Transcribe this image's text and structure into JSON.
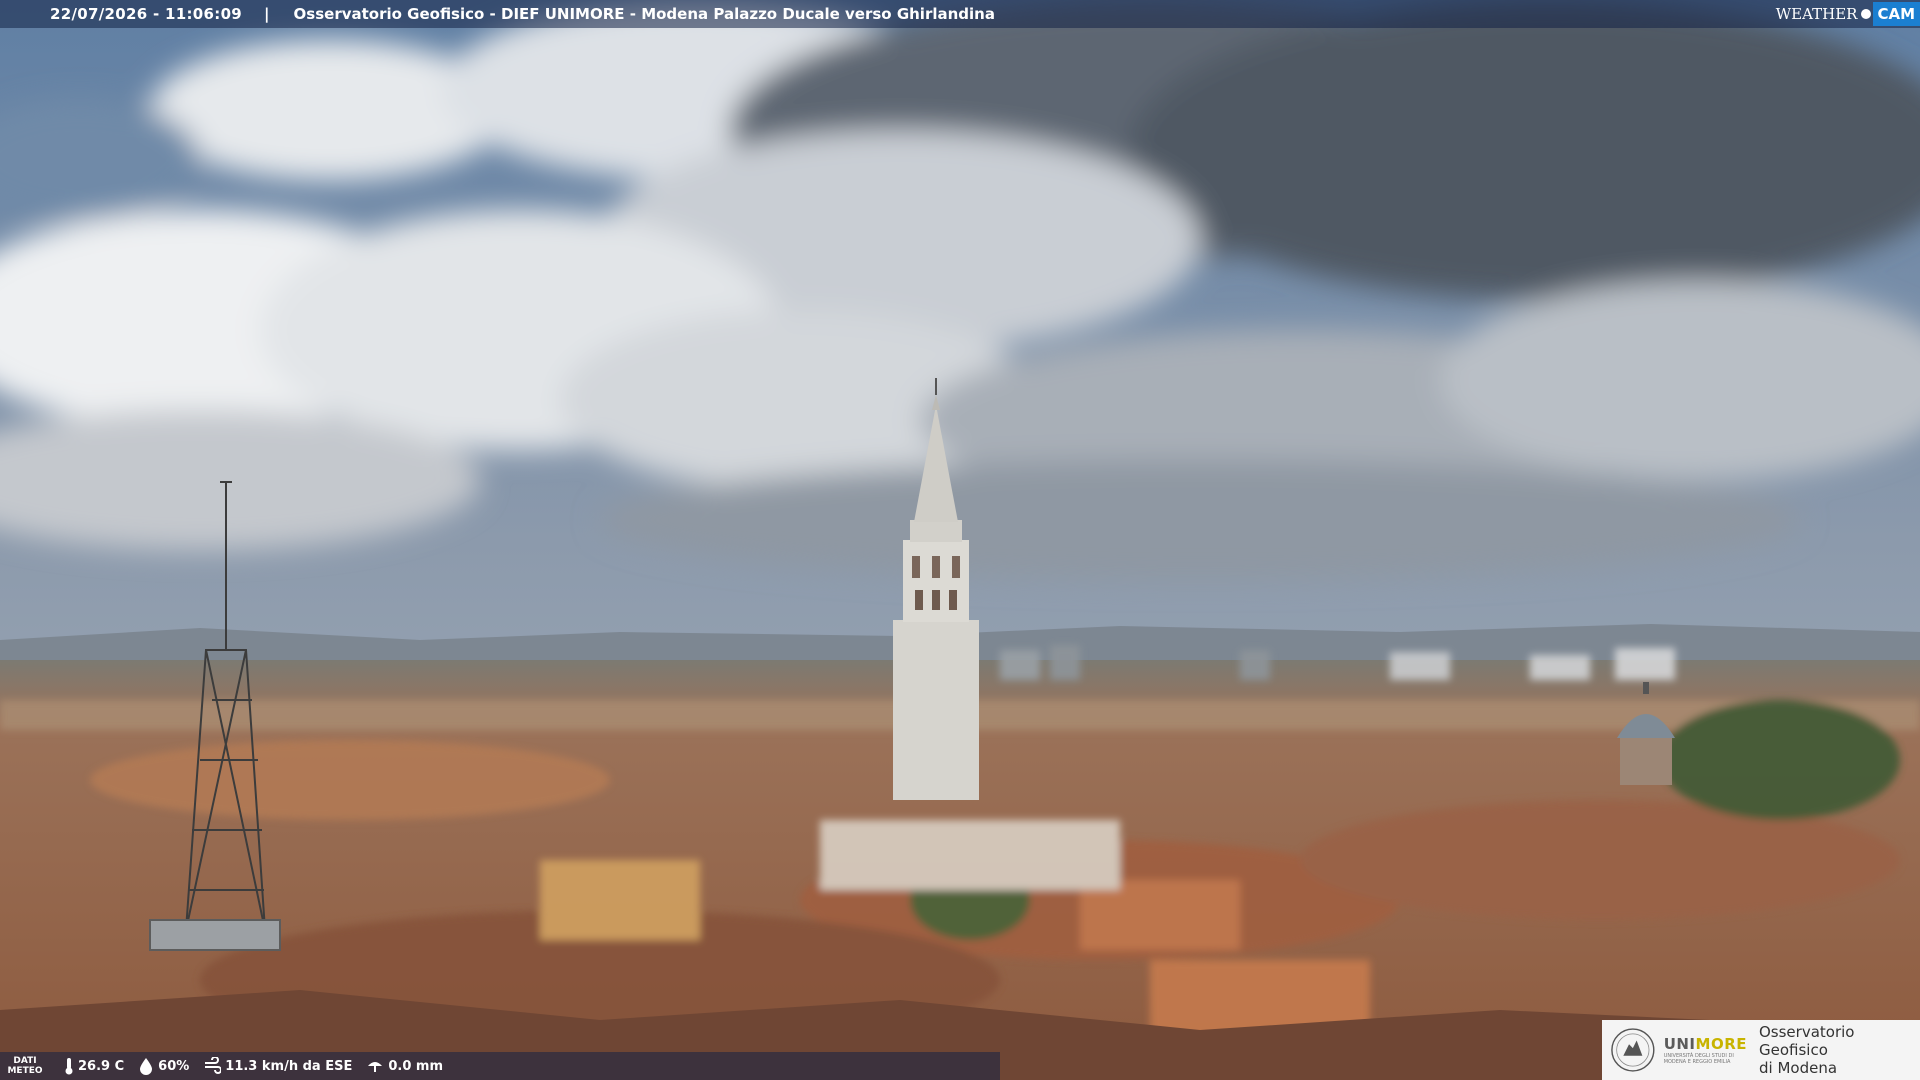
{
  "header": {
    "datetime": "22/07/2026 - 11:06:09",
    "separator": "|",
    "title": "Osservatorio Geofisico - DIEF UNIMORE - Modena Palazzo Ducale verso Ghirlandina"
  },
  "logo": {
    "weather": "WEATHER",
    "cam": "CAM"
  },
  "meteo": {
    "label_line1": "DATI",
    "label_line2": "METEO",
    "temperature": "26.9 C",
    "humidity": "60%",
    "wind": "11.3 km/h da ESE",
    "rain": "0.0 mm",
    "icons": [
      "thermometer-icon",
      "humidity-drop-icon",
      "wind-icon",
      "rain-icon"
    ]
  },
  "branding": {
    "uni_name_a": "UNI",
    "uni_name_b": "MORE",
    "uni_sub": "UNIVERSITÀ DEGLI STUDI DI MODENA E REGGIO EMILIA",
    "obs_line1": "Osservatorio Geofisico",
    "obs_line2": "di Modena"
  },
  "colors": {
    "sky": "#6f8ca8",
    "clouds": "#e9ecef",
    "roofs": "#a0674a",
    "cam_blue": "#1b7fd1",
    "unimore_yellow": "#c8b400"
  }
}
